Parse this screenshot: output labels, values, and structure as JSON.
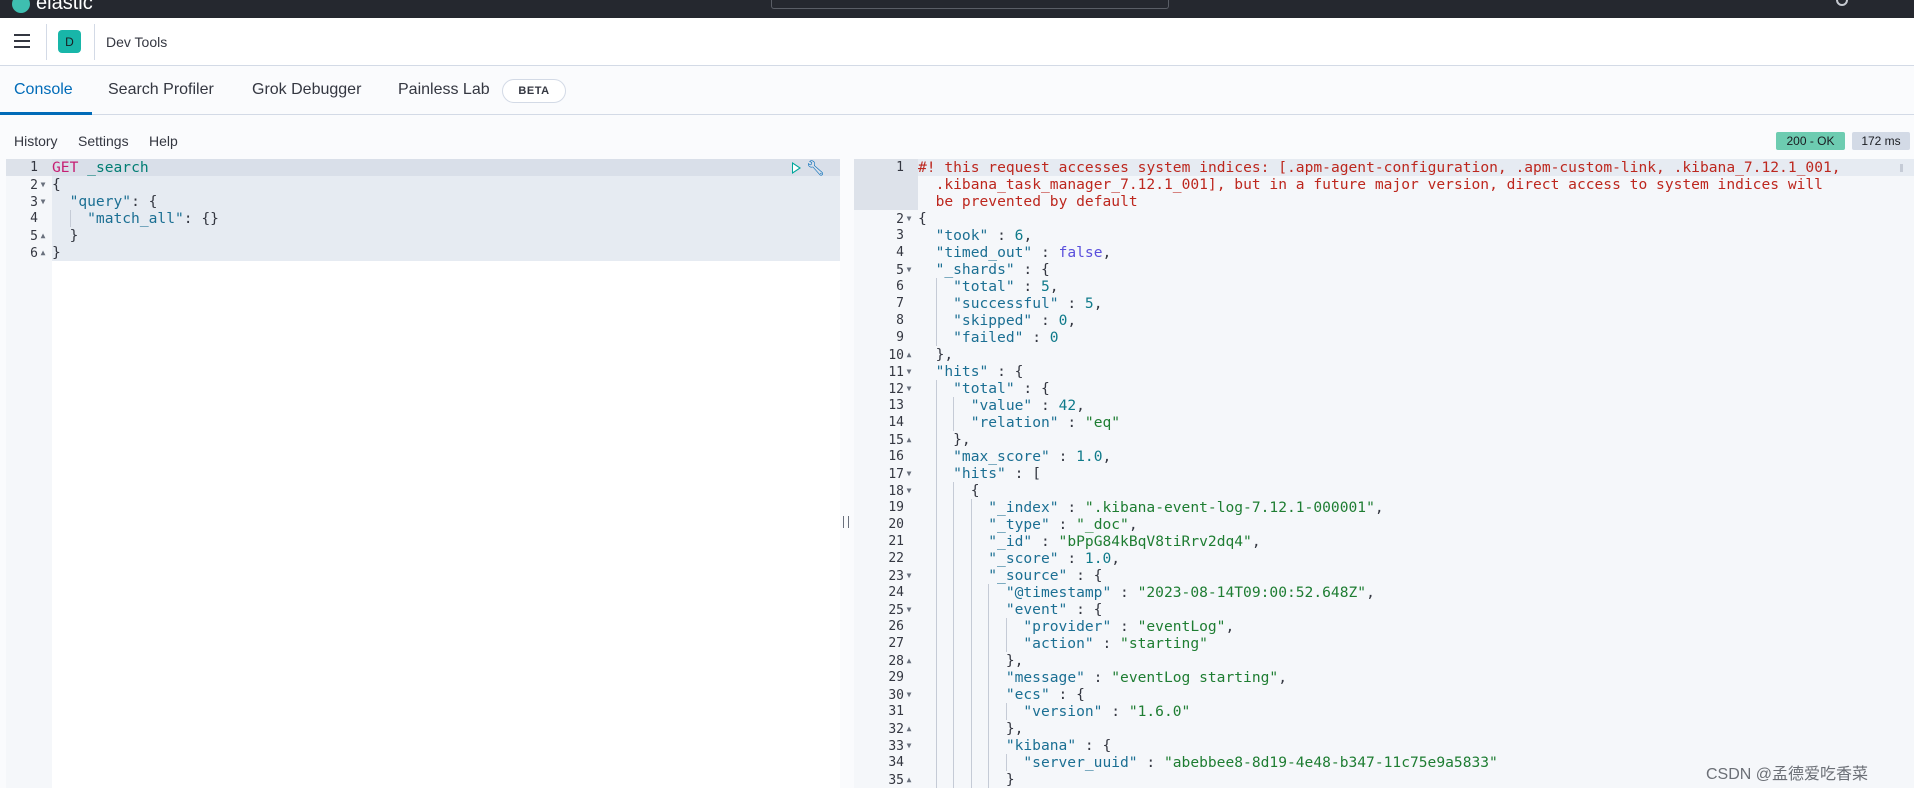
{
  "topbar": {
    "logo_text": "elastic"
  },
  "header": {
    "avatar_letter": "D",
    "title": "Dev Tools"
  },
  "tabs": [
    {
      "label": "Console",
      "active": true
    },
    {
      "label": "Search Profiler"
    },
    {
      "label": "Grok Debugger"
    },
    {
      "label": "Painless Lab",
      "badge": "BETA"
    }
  ],
  "toolbar": {
    "history": "History",
    "settings": "Settings",
    "help": "Help"
  },
  "status": {
    "code": "200 - OK",
    "time": "172 ms",
    "ok_color": "#6dccb1"
  },
  "watermark": "CSDN @孟德爱吃香菜",
  "request_editor": {
    "lines": [
      {
        "n": "1",
        "fold": "",
        "indent": 0,
        "tokens": [
          [
            "m",
            "GET"
          ],
          [
            "p",
            " "
          ],
          [
            "u",
            "_search"
          ]
        ]
      },
      {
        "n": "2",
        "fold": "open",
        "indent": 0,
        "tokens": [
          [
            "p",
            "{"
          ]
        ]
      },
      {
        "n": "3",
        "fold": "open",
        "indent": 1,
        "tokens": [
          [
            "k",
            "\"query\""
          ],
          [
            "p",
            ": {"
          ]
        ]
      },
      {
        "n": "4",
        "fold": "",
        "indent": 2,
        "tokens": [
          [
            "k",
            "\"match_all\""
          ],
          [
            "p",
            ": {}"
          ]
        ]
      },
      {
        "n": "5",
        "fold": "close",
        "indent": 1,
        "tokens": [
          [
            "p",
            "}"
          ]
        ]
      },
      {
        "n": "6",
        "fold": "close",
        "indent": 0,
        "tokens": [
          [
            "p",
            "}"
          ]
        ]
      }
    ]
  },
  "response_editor": {
    "lines": [
      {
        "n": "1",
        "fold": "",
        "indent": 0,
        "tokens": [
          [
            "c",
            "#! this request accesses system indices: [.apm-agent-configuration, .apm-custom-link, .kibana_7.12.1_001, .kibana_task_manager_7.12.1_001], but in a future major version, direct access to system indices will be prevented by default"
          ]
        ]
      },
      {
        "n": "2",
        "fold": "open",
        "indent": 0,
        "tokens": [
          [
            "p",
            "{"
          ]
        ]
      },
      {
        "n": "3",
        "fold": "",
        "indent": 1,
        "tokens": [
          [
            "k",
            "\"took\""
          ],
          [
            "p",
            " : "
          ],
          [
            "n",
            "6"
          ],
          [
            "p",
            ","
          ]
        ]
      },
      {
        "n": "4",
        "fold": "",
        "indent": 1,
        "tokens": [
          [
            "k",
            "\"timed_out\""
          ],
          [
            "p",
            " : "
          ],
          [
            "b",
            "false"
          ],
          [
            "p",
            ","
          ]
        ]
      },
      {
        "n": "5",
        "fold": "open",
        "indent": 1,
        "tokens": [
          [
            "k",
            "\"_shards\""
          ],
          [
            "p",
            " : {"
          ]
        ]
      },
      {
        "n": "6",
        "fold": "",
        "indent": 2,
        "tokens": [
          [
            "k",
            "\"total\""
          ],
          [
            "p",
            " : "
          ],
          [
            "n",
            "5"
          ],
          [
            "p",
            ","
          ]
        ]
      },
      {
        "n": "7",
        "fold": "",
        "indent": 2,
        "tokens": [
          [
            "k",
            "\"successful\""
          ],
          [
            "p",
            " : "
          ],
          [
            "n",
            "5"
          ],
          [
            "p",
            ","
          ]
        ]
      },
      {
        "n": "8",
        "fold": "",
        "indent": 2,
        "tokens": [
          [
            "k",
            "\"skipped\""
          ],
          [
            "p",
            " : "
          ],
          [
            "n",
            "0"
          ],
          [
            "p",
            ","
          ]
        ]
      },
      {
        "n": "9",
        "fold": "",
        "indent": 2,
        "tokens": [
          [
            "k",
            "\"failed\""
          ],
          [
            "p",
            " : "
          ],
          [
            "n",
            "0"
          ]
        ]
      },
      {
        "n": "10",
        "fold": "close",
        "indent": 1,
        "tokens": [
          [
            "p",
            "},"
          ]
        ]
      },
      {
        "n": "11",
        "fold": "open",
        "indent": 1,
        "tokens": [
          [
            "k",
            "\"hits\""
          ],
          [
            "p",
            " : {"
          ]
        ]
      },
      {
        "n": "12",
        "fold": "open",
        "indent": 2,
        "tokens": [
          [
            "k",
            "\"total\""
          ],
          [
            "p",
            " : {"
          ]
        ]
      },
      {
        "n": "13",
        "fold": "",
        "indent": 3,
        "tokens": [
          [
            "k",
            "\"value\""
          ],
          [
            "p",
            " : "
          ],
          [
            "n",
            "42"
          ],
          [
            "p",
            ","
          ]
        ]
      },
      {
        "n": "14",
        "fold": "",
        "indent": 3,
        "tokens": [
          [
            "k",
            "\"relation\""
          ],
          [
            "p",
            " : "
          ],
          [
            "s",
            "\"eq\""
          ]
        ]
      },
      {
        "n": "15",
        "fold": "close",
        "indent": 2,
        "tokens": [
          [
            "p",
            "},"
          ]
        ]
      },
      {
        "n": "16",
        "fold": "",
        "indent": 2,
        "tokens": [
          [
            "k",
            "\"max_score\""
          ],
          [
            "p",
            " : "
          ],
          [
            "n",
            "1.0"
          ],
          [
            "p",
            ","
          ]
        ]
      },
      {
        "n": "17",
        "fold": "open",
        "indent": 2,
        "tokens": [
          [
            "k",
            "\"hits\""
          ],
          [
            "p",
            " : ["
          ]
        ]
      },
      {
        "n": "18",
        "fold": "open",
        "indent": 3,
        "tokens": [
          [
            "p",
            "{"
          ]
        ]
      },
      {
        "n": "19",
        "fold": "",
        "indent": 4,
        "tokens": [
          [
            "k",
            "\"_index\""
          ],
          [
            "p",
            " : "
          ],
          [
            "s",
            "\".kibana-event-log-7.12.1-000001\""
          ],
          [
            "p",
            ","
          ]
        ]
      },
      {
        "n": "20",
        "fold": "",
        "indent": 4,
        "tokens": [
          [
            "k",
            "\"_type\""
          ],
          [
            "p",
            " : "
          ],
          [
            "s",
            "\"_doc\""
          ],
          [
            "p",
            ","
          ]
        ]
      },
      {
        "n": "21",
        "fold": "",
        "indent": 4,
        "tokens": [
          [
            "k",
            "\"_id\""
          ],
          [
            "p",
            " : "
          ],
          [
            "s",
            "\"bPpG84kBqV8tiRrv2dq4\""
          ],
          [
            "p",
            ","
          ]
        ]
      },
      {
        "n": "22",
        "fold": "",
        "indent": 4,
        "tokens": [
          [
            "k",
            "\"_score\""
          ],
          [
            "p",
            " : "
          ],
          [
            "n",
            "1.0"
          ],
          [
            "p",
            ","
          ]
        ]
      },
      {
        "n": "23",
        "fold": "open",
        "indent": 4,
        "tokens": [
          [
            "k",
            "\"_source\""
          ],
          [
            "p",
            " : {"
          ]
        ]
      },
      {
        "n": "24",
        "fold": "",
        "indent": 5,
        "tokens": [
          [
            "k",
            "\"@timestamp\""
          ],
          [
            "p",
            " : "
          ],
          [
            "s",
            "\"2023-08-14T09:00:52.648Z\""
          ],
          [
            "p",
            ","
          ]
        ]
      },
      {
        "n": "25",
        "fold": "open",
        "indent": 5,
        "tokens": [
          [
            "k",
            "\"event\""
          ],
          [
            "p",
            " : {"
          ]
        ]
      },
      {
        "n": "26",
        "fold": "",
        "indent": 6,
        "tokens": [
          [
            "k",
            "\"provider\""
          ],
          [
            "p",
            " : "
          ],
          [
            "s",
            "\"eventLog\""
          ],
          [
            "p",
            ","
          ]
        ]
      },
      {
        "n": "27",
        "fold": "",
        "indent": 6,
        "tokens": [
          [
            "k",
            "\"action\""
          ],
          [
            "p",
            " : "
          ],
          [
            "s",
            "\"starting\""
          ]
        ]
      },
      {
        "n": "28",
        "fold": "close",
        "indent": 5,
        "tokens": [
          [
            "p",
            "},"
          ]
        ]
      },
      {
        "n": "29",
        "fold": "",
        "indent": 5,
        "tokens": [
          [
            "k",
            "\"message\""
          ],
          [
            "p",
            " : "
          ],
          [
            "s",
            "\"eventLog starting\""
          ],
          [
            "p",
            ","
          ]
        ]
      },
      {
        "n": "30",
        "fold": "open",
        "indent": 5,
        "tokens": [
          [
            "k",
            "\"ecs\""
          ],
          [
            "p",
            " : {"
          ]
        ]
      },
      {
        "n": "31",
        "fold": "",
        "indent": 6,
        "tokens": [
          [
            "k",
            "\"version\""
          ],
          [
            "p",
            " : "
          ],
          [
            "s",
            "\"1.6.0\""
          ]
        ]
      },
      {
        "n": "32",
        "fold": "close",
        "indent": 5,
        "tokens": [
          [
            "p",
            "},"
          ]
        ]
      },
      {
        "n": "33",
        "fold": "open",
        "indent": 5,
        "tokens": [
          [
            "k",
            "\"kibana\""
          ],
          [
            "p",
            " : {"
          ]
        ]
      },
      {
        "n": "34",
        "fold": "",
        "indent": 6,
        "tokens": [
          [
            "k",
            "\"server_uuid\""
          ],
          [
            "p",
            " : "
          ],
          [
            "s",
            "\"abebbee8-8d19-4e48-b347-11c75e9a5833\""
          ]
        ]
      },
      {
        "n": "35",
        "fold": "close",
        "indent": 5,
        "tokens": [
          [
            "p",
            "}"
          ]
        ]
      }
    ]
  }
}
